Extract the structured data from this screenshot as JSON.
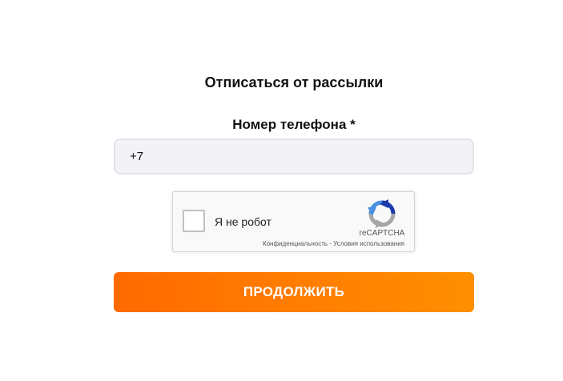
{
  "form": {
    "title": "Отписаться от рассылки",
    "phone_label": "Номер телефона *",
    "phone_value": "+7",
    "submit_label": "ПРОДОЛЖИТЬ"
  },
  "captcha": {
    "checkbox_label": "Я не робот",
    "brand": "reCAPTCHA",
    "privacy_link": "Конфиденциальность",
    "separator": " - ",
    "terms_link": "Условия использования",
    "logo_icon": "recaptcha-icon"
  },
  "colors": {
    "accent_start": "#ff6a00",
    "accent_end": "#ff8f00",
    "input_background": "#f3f2f7"
  }
}
